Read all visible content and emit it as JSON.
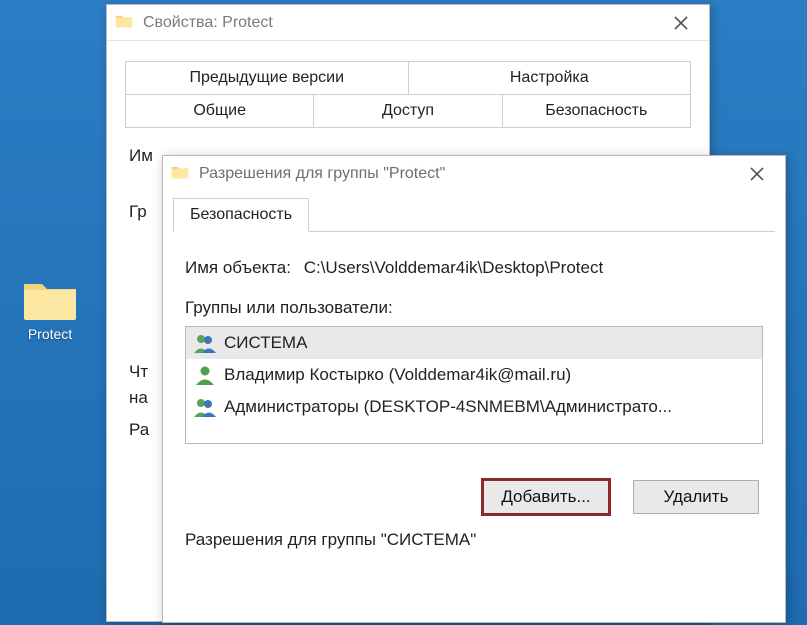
{
  "desktop": {
    "folder_label": "Protect"
  },
  "properties_window": {
    "title": "Свойства: Protect",
    "tabs_row1": [
      "Предыдущие версии",
      "Настройка"
    ],
    "tabs_row2": [
      "Общие",
      "Доступ",
      "Безопасность"
    ],
    "selected_tab": "Безопасность",
    "object_label_trunc": "Им",
    "groups_label_trunc": "Гр",
    "body_line1": "Чт",
    "body_line2": "на",
    "body_line3": "Ра"
  },
  "permissions_window": {
    "title": "Разрешения для группы \"Protect\"",
    "tab": "Безопасность",
    "object_label": "Имя объекта:",
    "object_path": "C:\\Users\\Volddemar4ik\\Desktop\\Protect",
    "groups_label": "Группы или пользователи:",
    "list": [
      {
        "name": "СИСТЕМА",
        "icon": "group",
        "selected": true
      },
      {
        "name": "Владимир Костырко (Volddemar4ik@mail.ru)",
        "icon": "user",
        "selected": false
      },
      {
        "name": "Администраторы (DESKTOP-4SNMEBM\\Администрато...",
        "icon": "group",
        "selected": false
      }
    ],
    "buttons": {
      "add": "Добавить...",
      "remove": "Удалить"
    },
    "permissions_for_label": "Разрешения для группы \"СИСТЕМА\""
  }
}
